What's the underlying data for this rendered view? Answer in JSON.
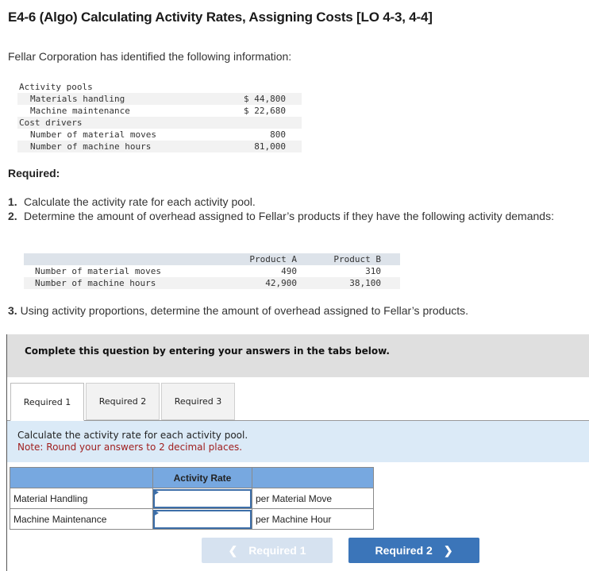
{
  "title": "E4-6 (Algo) Calculating Activity Rates, Assigning Costs [LO 4-3, 4-4]",
  "intro": "Fellar Corporation has identified the following information:",
  "info_table": {
    "activity_pools_label": "Activity pools",
    "pools": [
      {
        "label": "Materials handling",
        "value": "$ 44,800"
      },
      {
        "label": "Machine maintenance",
        "value": "$ 22,680"
      }
    ],
    "cost_drivers_label": "Cost drivers",
    "drivers": [
      {
        "label": "Number of material moves",
        "value": "800"
      },
      {
        "label": "Number of machine hours",
        "value": "81,000"
      }
    ]
  },
  "required_heading": "Required:",
  "requirements": [
    {
      "num": "1.",
      "text": "Calculate the activity rate for each activity pool."
    },
    {
      "num": "2.",
      "text": "Determine the amount of overhead assigned to Fellar’s products if they have the following activity demands:"
    }
  ],
  "demand_table": {
    "headers": [
      "",
      "Product A",
      "Product B"
    ],
    "rows": [
      {
        "label": "Number of material moves",
        "a": "490",
        "b": "310"
      },
      {
        "label": "Number of machine hours",
        "a": "42,900",
        "b": "38,100"
      }
    ]
  },
  "requirement3": {
    "num": "3.",
    "text": "Using activity proportions, determine the amount of overhead assigned to Fellar’s products."
  },
  "instruction": "Complete this question by entering your answers in the tabs below.",
  "tabs": [
    {
      "label": "Required 1",
      "active": true
    },
    {
      "label": "Required 2",
      "active": false
    },
    {
      "label": "Required 3",
      "active": false
    }
  ],
  "prompt": {
    "text": "Calculate the activity rate for each activity pool.",
    "note": "Note: Round your answers to 2 decimal places."
  },
  "rate_table": {
    "header": "Activity Rate",
    "rows": [
      {
        "label": "Material Handling",
        "value": "",
        "unit": "per Material Move"
      },
      {
        "label": "Machine Maintenance",
        "value": "",
        "unit": "per Machine Hour"
      }
    ]
  },
  "nav": {
    "prev_label": "Required 1",
    "next_label": "Required 2",
    "prev_icon": "chevron-left-icon",
    "next_icon": "chevron-right-icon"
  },
  "colors": {
    "table_header": "#77a8e0",
    "next_button": "#3b75b9",
    "prev_button_disabled": "#d6e2f0",
    "note_text": "#a02020",
    "prompt_bg": "#dbeaf7"
  }
}
